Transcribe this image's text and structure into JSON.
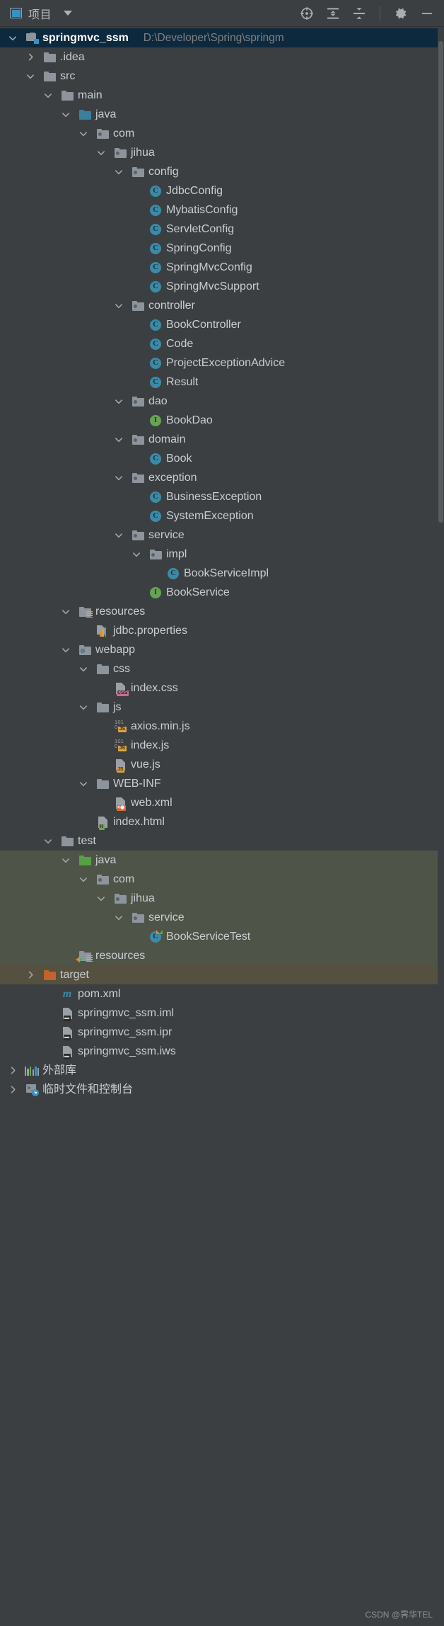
{
  "toolbar": {
    "title": "项目",
    "window_icon": "project-window-icon",
    "dropdown_icon": "chevron-down-icon",
    "actions": [
      {
        "name": "select-opened-file-icon",
        "label": "定位"
      },
      {
        "name": "expand-all-icon",
        "label": "全部展开"
      },
      {
        "name": "collapse-all-icon",
        "label": "全部折叠"
      },
      {
        "name": "settings-gear-icon",
        "label": "设置"
      },
      {
        "name": "hide-minimize-icon",
        "label": "隐藏"
      }
    ]
  },
  "colors": {
    "background": "#3c3f41",
    "selected_row": "#0d293e",
    "test_highlight": "#4e5548",
    "target_highlight": "#55503f",
    "accent_blue": "#3592c4",
    "class_icon": "#3b8aa8",
    "interface_icon": "#67a354",
    "folder_gray": "#8d949c",
    "folder_orange": "#c4622d",
    "folder_green": "#56a142",
    "text": "#c8cdd2",
    "path_text": "#808080"
  },
  "watermark": "CSDN @霁华TEL",
  "tree": [
    {
      "label": "springmvc_ssm",
      "path": "D:\\Developer\\Spring\\springm",
      "depth": 0,
      "arrow": "down",
      "icon": "module",
      "bold": true,
      "selected": true
    },
    {
      "label": ".idea",
      "depth": 1,
      "arrow": "right",
      "icon": "folder-gray"
    },
    {
      "label": "src",
      "depth": 1,
      "arrow": "down",
      "icon": "folder-gray"
    },
    {
      "label": "main",
      "depth": 2,
      "arrow": "down",
      "icon": "folder-gray"
    },
    {
      "label": "java",
      "depth": 3,
      "arrow": "down",
      "icon": "folder-blue"
    },
    {
      "label": "com",
      "depth": 4,
      "arrow": "down",
      "icon": "folder-package"
    },
    {
      "label": "jihua",
      "depth": 5,
      "arrow": "down",
      "icon": "folder-package"
    },
    {
      "label": "config",
      "depth": 6,
      "arrow": "down",
      "icon": "folder-package"
    },
    {
      "label": "JdbcConfig",
      "depth": 7,
      "icon": "java-class"
    },
    {
      "label": "MybatisConfig",
      "depth": 7,
      "icon": "java-class"
    },
    {
      "label": "ServletConfig",
      "depth": 7,
      "icon": "java-class"
    },
    {
      "label": "SpringConfig",
      "depth": 7,
      "icon": "java-class"
    },
    {
      "label": "SpringMvcConfig",
      "depth": 7,
      "icon": "java-class"
    },
    {
      "label": "SpringMvcSupport",
      "depth": 7,
      "icon": "java-class"
    },
    {
      "label": "controller",
      "depth": 6,
      "arrow": "down",
      "icon": "folder-package"
    },
    {
      "label": "BookController",
      "depth": 7,
      "icon": "java-class"
    },
    {
      "label": "Code",
      "depth": 7,
      "icon": "java-class"
    },
    {
      "label": "ProjectExceptionAdvice",
      "depth": 7,
      "icon": "java-class"
    },
    {
      "label": "Result",
      "depth": 7,
      "icon": "java-class"
    },
    {
      "label": "dao",
      "depth": 6,
      "arrow": "down",
      "icon": "folder-package"
    },
    {
      "label": "BookDao",
      "depth": 7,
      "icon": "java-interface"
    },
    {
      "label": "domain",
      "depth": 6,
      "arrow": "down",
      "icon": "folder-package"
    },
    {
      "label": "Book",
      "depth": 7,
      "icon": "java-class"
    },
    {
      "label": "exception",
      "depth": 6,
      "arrow": "down",
      "icon": "folder-package"
    },
    {
      "label": "BusinessException",
      "depth": 7,
      "icon": "java-class"
    },
    {
      "label": "SystemException",
      "depth": 7,
      "icon": "java-class"
    },
    {
      "label": "service",
      "depth": 6,
      "arrow": "down",
      "icon": "folder-package"
    },
    {
      "label": "impl",
      "depth": 7,
      "arrow": "down",
      "icon": "folder-package"
    },
    {
      "label": "BookServiceImpl",
      "depth": 8,
      "icon": "java-class"
    },
    {
      "label": "BookService",
      "depth": 7,
      "icon": "java-interface"
    },
    {
      "label": "resources",
      "depth": 3,
      "arrow": "down",
      "icon": "folder-resources"
    },
    {
      "label": "jdbc.properties",
      "depth": 4,
      "icon": "properties-file"
    },
    {
      "label": "webapp",
      "depth": 3,
      "arrow": "down",
      "icon": "folder-webapp"
    },
    {
      "label": "css",
      "depth": 4,
      "arrow": "down",
      "icon": "folder-gray"
    },
    {
      "label": "index.css",
      "depth": 5,
      "icon": "css-file"
    },
    {
      "label": "js",
      "depth": 4,
      "arrow": "down",
      "icon": "folder-gray"
    },
    {
      "label": "axios.min.js",
      "depth": 5,
      "icon": "js-min-file"
    },
    {
      "label": "index.js",
      "depth": 5,
      "icon": "js-min-file"
    },
    {
      "label": "vue.js",
      "depth": 5,
      "icon": "js-file"
    },
    {
      "label": "WEB-INF",
      "depth": 4,
      "arrow": "down",
      "icon": "folder-gray"
    },
    {
      "label": "web.xml",
      "depth": 5,
      "icon": "webxml-file"
    },
    {
      "label": "index.html",
      "depth": 4,
      "icon": "html-file"
    },
    {
      "label": "test",
      "depth": 2,
      "arrow": "down",
      "icon": "folder-gray"
    },
    {
      "label": "java",
      "depth": 3,
      "arrow": "down",
      "icon": "folder-green",
      "highlight": "green"
    },
    {
      "label": "com",
      "depth": 4,
      "arrow": "down",
      "icon": "folder-package",
      "highlight": "green"
    },
    {
      "label": "jihua",
      "depth": 5,
      "arrow": "down",
      "icon": "folder-package",
      "highlight": "green"
    },
    {
      "label": "service",
      "depth": 6,
      "arrow": "down",
      "icon": "folder-package",
      "highlight": "green"
    },
    {
      "label": "BookServiceTest",
      "depth": 7,
      "icon": "java-test-class",
      "highlight": "green"
    },
    {
      "label": "resources",
      "depth": 3,
      "icon": "folder-test-resources",
      "highlight": "green"
    },
    {
      "label": "target",
      "depth": 1,
      "arrow": "right",
      "icon": "folder-orange",
      "highlight": "brown"
    },
    {
      "label": "pom.xml",
      "depth": 2,
      "icon": "maven-file"
    },
    {
      "label": "springmvc_ssm.iml",
      "depth": 2,
      "icon": "iml-file"
    },
    {
      "label": "springmvc_ssm.ipr",
      "depth": 2,
      "icon": "iml-file"
    },
    {
      "label": "springmvc_ssm.iws",
      "depth": 2,
      "icon": "iml-file"
    },
    {
      "label": "外部库",
      "depth": 0,
      "arrow": "right",
      "icon": "external-libraries"
    },
    {
      "label": "临时文件和控制台",
      "depth": 0,
      "arrow": "right",
      "icon": "scratches-consoles"
    }
  ]
}
